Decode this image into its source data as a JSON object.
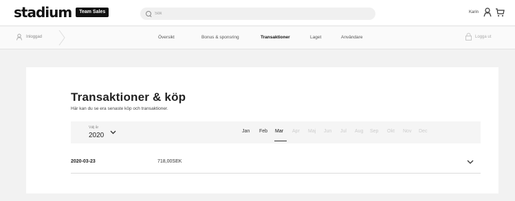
{
  "header": {
    "logo_text": "stadium",
    "logo_badge": "Team Sales",
    "search_placeholder": "Sök",
    "user_name": "Karin"
  },
  "subnav": {
    "login_label": "Inloggad",
    "links": [
      "Översikt",
      "Bonus & sponsring",
      "Transaktioner",
      "Laget",
      "Användare"
    ],
    "active_link": "Transaktioner",
    "logout_label": "Logga ut"
  },
  "page": {
    "title": "Transaktioner & köp",
    "subtitle": "Här kan du se era senaste köp och transaktioner."
  },
  "filter": {
    "year_label": "Välj år",
    "year_value": "2020",
    "months": [
      "Jan",
      "Feb",
      "Mar",
      "Apr",
      "Maj",
      "Jun",
      "Jul",
      "Aug",
      "Sep",
      "Okt",
      "Nov",
      "Dec"
    ],
    "available_months": [
      "Jan",
      "Feb",
      "Mar"
    ],
    "selected_month": "Mar"
  },
  "transactions": [
    {
      "date": "2020-03-23",
      "amount": "718,00SEK"
    }
  ],
  "icons": {
    "search": "search-icon",
    "user": "user-icon",
    "cart": "cart-icon",
    "logout": "lock-icon",
    "year_dropdown": "chevron-down-icon",
    "row_expand": "chevron-down-icon"
  }
}
